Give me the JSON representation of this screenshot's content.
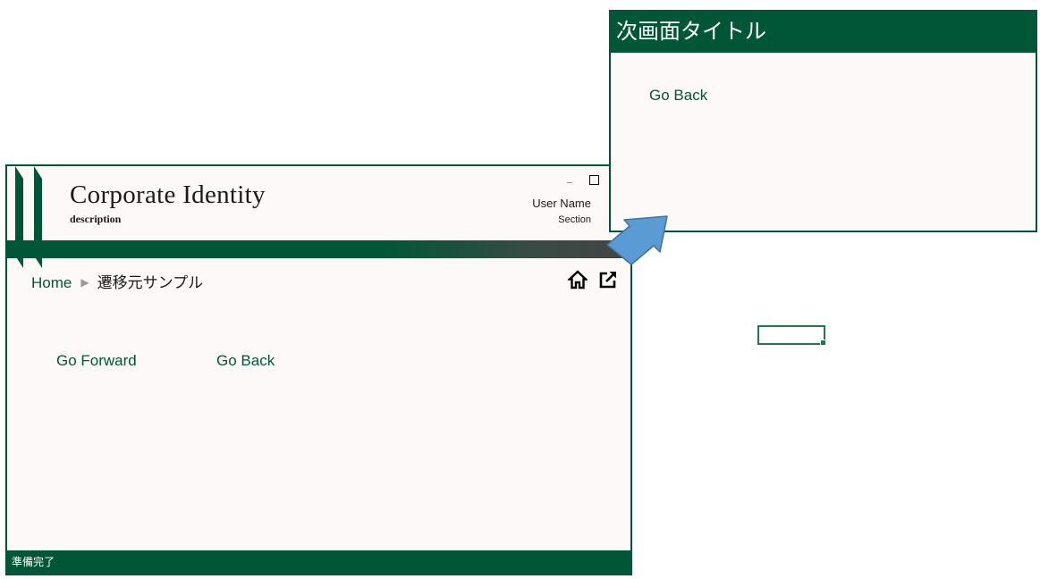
{
  "main": {
    "brand_title": "Corporate Identity",
    "brand_description": "description",
    "user_name": "User Name",
    "user_section": "Section",
    "minimize_glyph": "_",
    "breadcrumb": {
      "home": "Home",
      "separator": "▶",
      "current": "遷移元サンプル"
    },
    "links": {
      "forward": "Go Forward",
      "back": "Go Back"
    },
    "status": "準備完了"
  },
  "popup": {
    "title": "次画面タイトル",
    "back_link": "Go Back"
  },
  "icons": {
    "home": "home-icon",
    "open_window": "external-link-icon",
    "arrow": "arrow-up-right-icon"
  },
  "colors": {
    "brand_green": "#005738",
    "background": "#fcf9f8",
    "arrow_blue": "#5b9bd5",
    "cell_border": "#1e7b4f"
  }
}
